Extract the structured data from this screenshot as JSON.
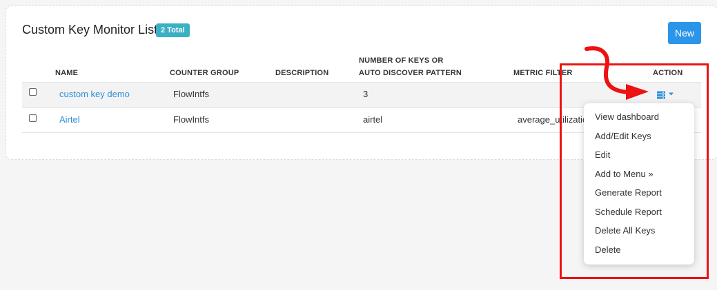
{
  "header": {
    "title": "Custom Key Monitor List",
    "badge": "2 Total",
    "new_label": "New"
  },
  "table": {
    "columns": {
      "name": "NAME",
      "counter_group": "COUNTER GROUP",
      "description": "DESCRIPTION",
      "keys_line1": "NUMBER OF KEYS OR",
      "keys_line2": "AUTO DISCOVER PATTERN",
      "metric_filter": "METRIC FILTER",
      "action": "ACTION"
    },
    "rows": [
      {
        "name": "custom key demo",
        "counter_group": "FlowIntfs",
        "description": "",
        "keys": "3",
        "metric_filter": ""
      },
      {
        "name": "Airtel",
        "counter_group": "FlowIntfs",
        "description": "",
        "keys": "airtel",
        "metric_filter": "average_utilization"
      }
    ]
  },
  "action_menu": {
    "items": [
      "View dashboard",
      "Add/Edit Keys",
      "Edit",
      "Add to Menu »",
      "Generate Report",
      "Schedule Report",
      "Delete All Keys",
      "Delete"
    ]
  },
  "colors": {
    "accent": "#2b95e9",
    "badge": "#3bb0c4",
    "annotation": "#ee1111",
    "link": "#2b8fd6"
  },
  "icons": {
    "action": "server-list-icon",
    "caret": "caret-down-icon"
  }
}
